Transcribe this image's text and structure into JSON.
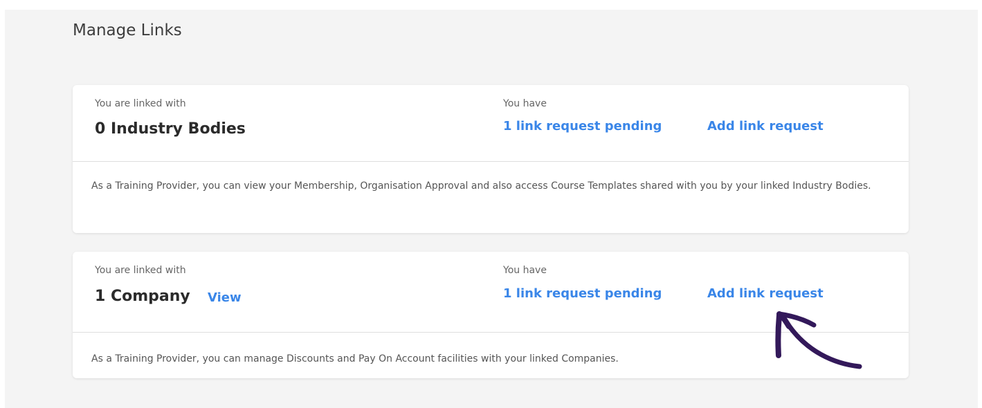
{
  "page": {
    "title": "Manage Links"
  },
  "industry_bodies": {
    "linked_label": "You are linked with",
    "count_text": "0 Industry Bodies",
    "have_label": "You have",
    "pending_link": "1 link request pending",
    "add_link": "Add link request",
    "description": "As a Training Provider, you can view your Membership, Organisation Approval and also access Course Templates shared with you by your linked Industry Bodies."
  },
  "companies": {
    "linked_label": "You are linked with",
    "count_text": "1 Company",
    "view_link": "View",
    "have_label": "You have",
    "pending_link": "1 link request pending",
    "add_link": "Add link request",
    "description": "As a Training Provider, you can manage Discounts and Pay On Account facilities with your linked Companies."
  },
  "annotation": {
    "icon": "hand-drawn-arrow-icon",
    "color": "#33195a"
  },
  "colors": {
    "link": "#3a86e8",
    "background": "#f4f4f4",
    "card": "#ffffff"
  }
}
